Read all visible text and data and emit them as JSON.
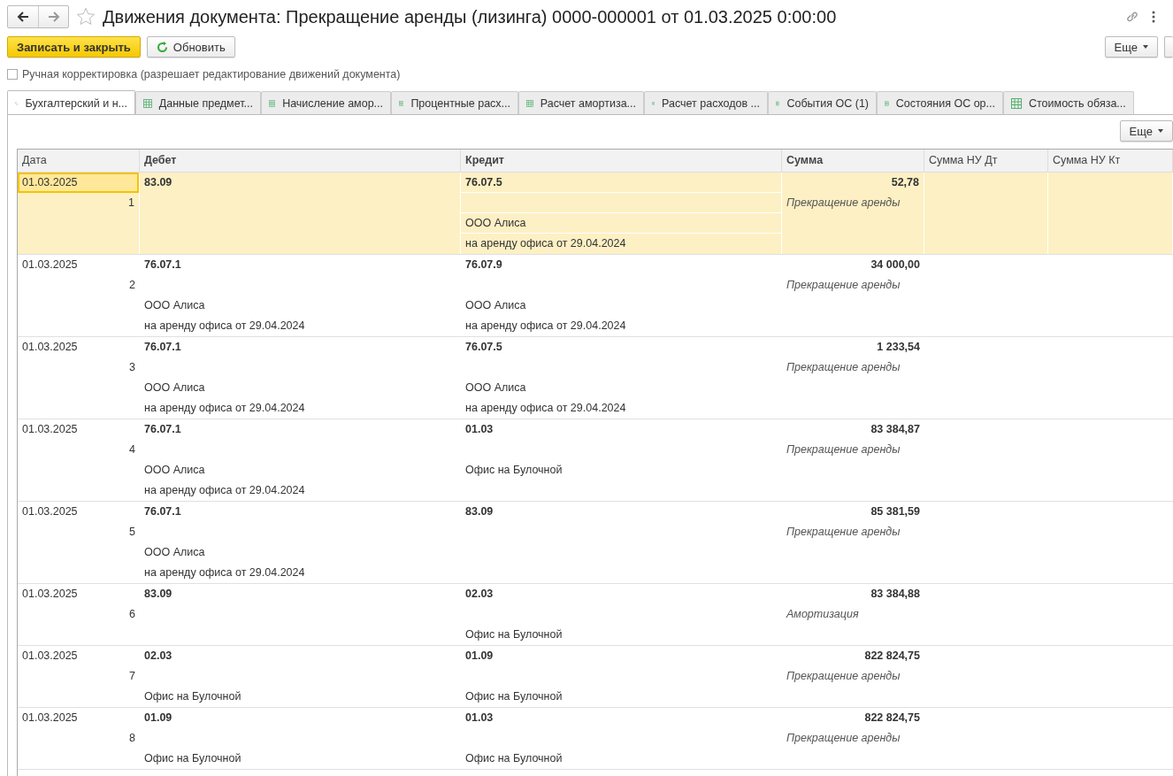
{
  "window": {
    "title": "Движения документа: Прекращение аренды (лизинга) 0000-000001 от 01.03.2025 0:00:00"
  },
  "toolbar": {
    "buttons": [
      {
        "label": "Записать и закрыть",
        "kind": "primary"
      },
      {
        "label": "Обновить",
        "kind": "refresh"
      }
    ],
    "more": "Еще"
  },
  "manual_correction": {
    "label": "Ручная корректировка (разрешает редактирование движений документа)",
    "checked": false
  },
  "tabs": [
    {
      "label": "Бухгалтерский и н...",
      "kind": "accounting",
      "selected": true
    },
    {
      "label": "Данные предмет...",
      "kind": "register",
      "selected": false
    },
    {
      "label": "Начисление амор...",
      "kind": "register",
      "selected": false
    },
    {
      "label": "Процентные расх...",
      "kind": "register",
      "selected": false
    },
    {
      "label": "Расчет амортиза...",
      "kind": "register",
      "selected": false
    },
    {
      "label": "Расчет расходов ...",
      "kind": "register",
      "selected": false
    },
    {
      "label": "События ОС (1)",
      "kind": "register",
      "selected": false
    },
    {
      "label": "Состояния ОС ор...",
      "kind": "register",
      "selected": false
    },
    {
      "label": "Стоимость обяза...",
      "kind": "register",
      "selected": false
    }
  ],
  "table": {
    "more": "Еще",
    "columns": [
      {
        "label": "Дата",
        "bold": false
      },
      {
        "label": "Дебет",
        "bold": true
      },
      {
        "label": "Кредит",
        "bold": true
      },
      {
        "label": "Сумма",
        "bold": true
      },
      {
        "label": "Сумма НУ Дт",
        "bold": false
      },
      {
        "label": "Сумма НУ Кт",
        "bold": false
      }
    ],
    "rows": [
      {
        "date": "01.03.2025",
        "number": "1",
        "debit": {
          "account": "83.09"
        },
        "credit": {
          "account": "76.07.5",
          "subconto": [
            "ООО Алиса",
            "на аренду офиса от 29.04.2024"
          ]
        },
        "sum": "52,78",
        "content": "Прекращение аренды",
        "selected": true
      },
      {
        "date": "01.03.2025",
        "number": "2",
        "debit": {
          "account": "76.07.1",
          "subconto": [
            "ООО Алиса",
            "на аренду офиса от 29.04.2024"
          ]
        },
        "credit": {
          "account": "76.07.9",
          "subconto": [
            "ООО Алиса",
            "на аренду офиса от 29.04.2024"
          ]
        },
        "sum": "34 000,00",
        "content": "Прекращение аренды",
        "selected": false
      },
      {
        "date": "01.03.2025",
        "number": "3",
        "debit": {
          "account": "76.07.1",
          "subconto": [
            "ООО Алиса",
            "на аренду офиса от 29.04.2024"
          ]
        },
        "credit": {
          "account": "76.07.5",
          "subconto": [
            "ООО Алиса",
            "на аренду офиса от 29.04.2024"
          ]
        },
        "sum": "1 233,54",
        "content": "Прекращение аренды",
        "selected": false
      },
      {
        "date": "01.03.2025",
        "number": "4",
        "debit": {
          "account": "76.07.1",
          "subconto": [
            "ООО Алиса",
            "на аренду офиса от 29.04.2024"
          ]
        },
        "credit": {
          "account": "01.03",
          "subconto": [
            "Офис на Булочной"
          ]
        },
        "sum": "83 384,87",
        "content": "Прекращение аренды",
        "selected": false
      },
      {
        "date": "01.03.2025",
        "number": "5",
        "debit": {
          "account": "76.07.1",
          "subconto": [
            "ООО Алиса",
            "на аренду офиса от 29.04.2024"
          ]
        },
        "credit": {
          "account": "83.09"
        },
        "sum": "85 381,59",
        "content": "Прекращение аренды",
        "selected": false
      },
      {
        "date": "01.03.2025",
        "number": "6",
        "debit": {
          "account": "83.09"
        },
        "credit": {
          "account": "02.03",
          "subconto": [
            "Офис на Булочной"
          ]
        },
        "sum": "83 384,88",
        "content": "Амортизация",
        "selected": false
      },
      {
        "date": "01.03.2025",
        "number": "7",
        "debit": {
          "account": "02.03",
          "subconto": [
            "Офис на Булочной"
          ]
        },
        "credit": {
          "account": "01.09",
          "subconto": [
            "Офис на Булочной"
          ]
        },
        "sum": "822 824,75",
        "content": "Прекращение аренды",
        "selected": false
      },
      {
        "date": "01.03.2025",
        "number": "8",
        "debit": {
          "account": "01.09",
          "subconto": [
            "Офис на Булочной"
          ]
        },
        "credit": {
          "account": "01.03",
          "subconto": [
            "Офис на Булочной"
          ]
        },
        "sum": "822 824,75",
        "content": "Прекращение аренды",
        "selected": false
      }
    ]
  }
}
